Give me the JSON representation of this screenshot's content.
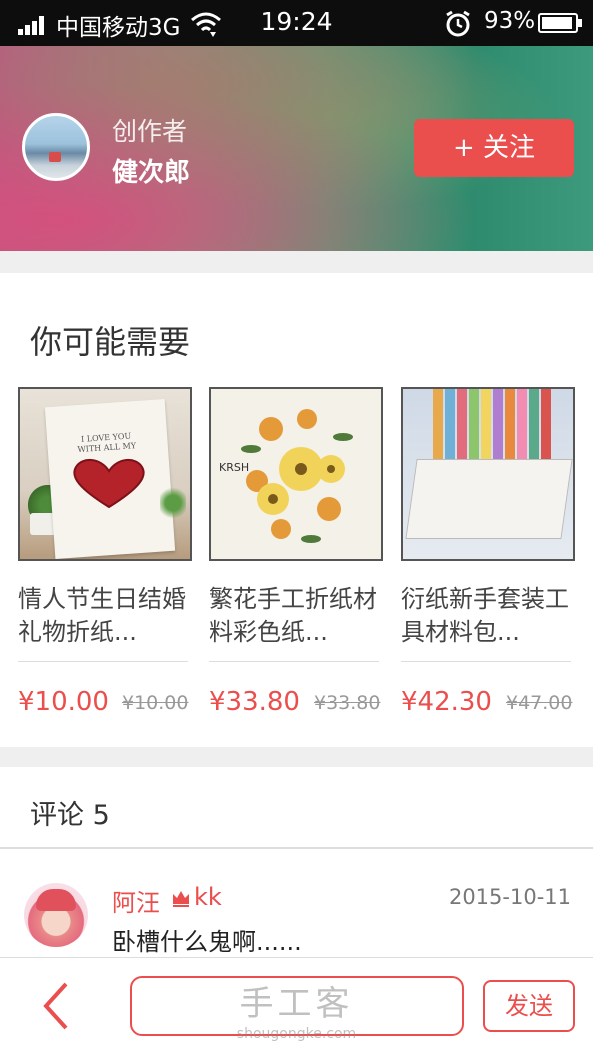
{
  "status_bar": {
    "carrier": "中国移动3G",
    "time": "19:24",
    "battery": "93%",
    "battery_level": 0.93
  },
  "author": {
    "role": "创作者",
    "name": "健次郎",
    "follow_label": "+ 关注"
  },
  "need_section": {
    "title": "你可能需要",
    "products": [
      {
        "name": "情人节生日结婚礼物折纸...",
        "price": "¥10.00",
        "old_price": "¥10.00"
      },
      {
        "name": "繁花手工折纸材料彩色纸...",
        "price": "¥33.80",
        "old_price": "¥33.80"
      },
      {
        "name": "衍纸新手套装工具材料包...",
        "price": "¥42.30",
        "old_price": "¥47.00"
      }
    ]
  },
  "comments": {
    "title": "评论 5",
    "items": [
      {
        "user_prefix": "阿汪",
        "user_suffix": "kk",
        "date": "2015-10-11",
        "text": "卧槽什么鬼啊......"
      }
    ]
  },
  "bottom_bar": {
    "watermark": "手工客",
    "watermark_sub": "shougongke.com",
    "send_label": "发送"
  },
  "colors": {
    "accent": "#ea4e4d",
    "status_bar": "#0d0d0d"
  }
}
